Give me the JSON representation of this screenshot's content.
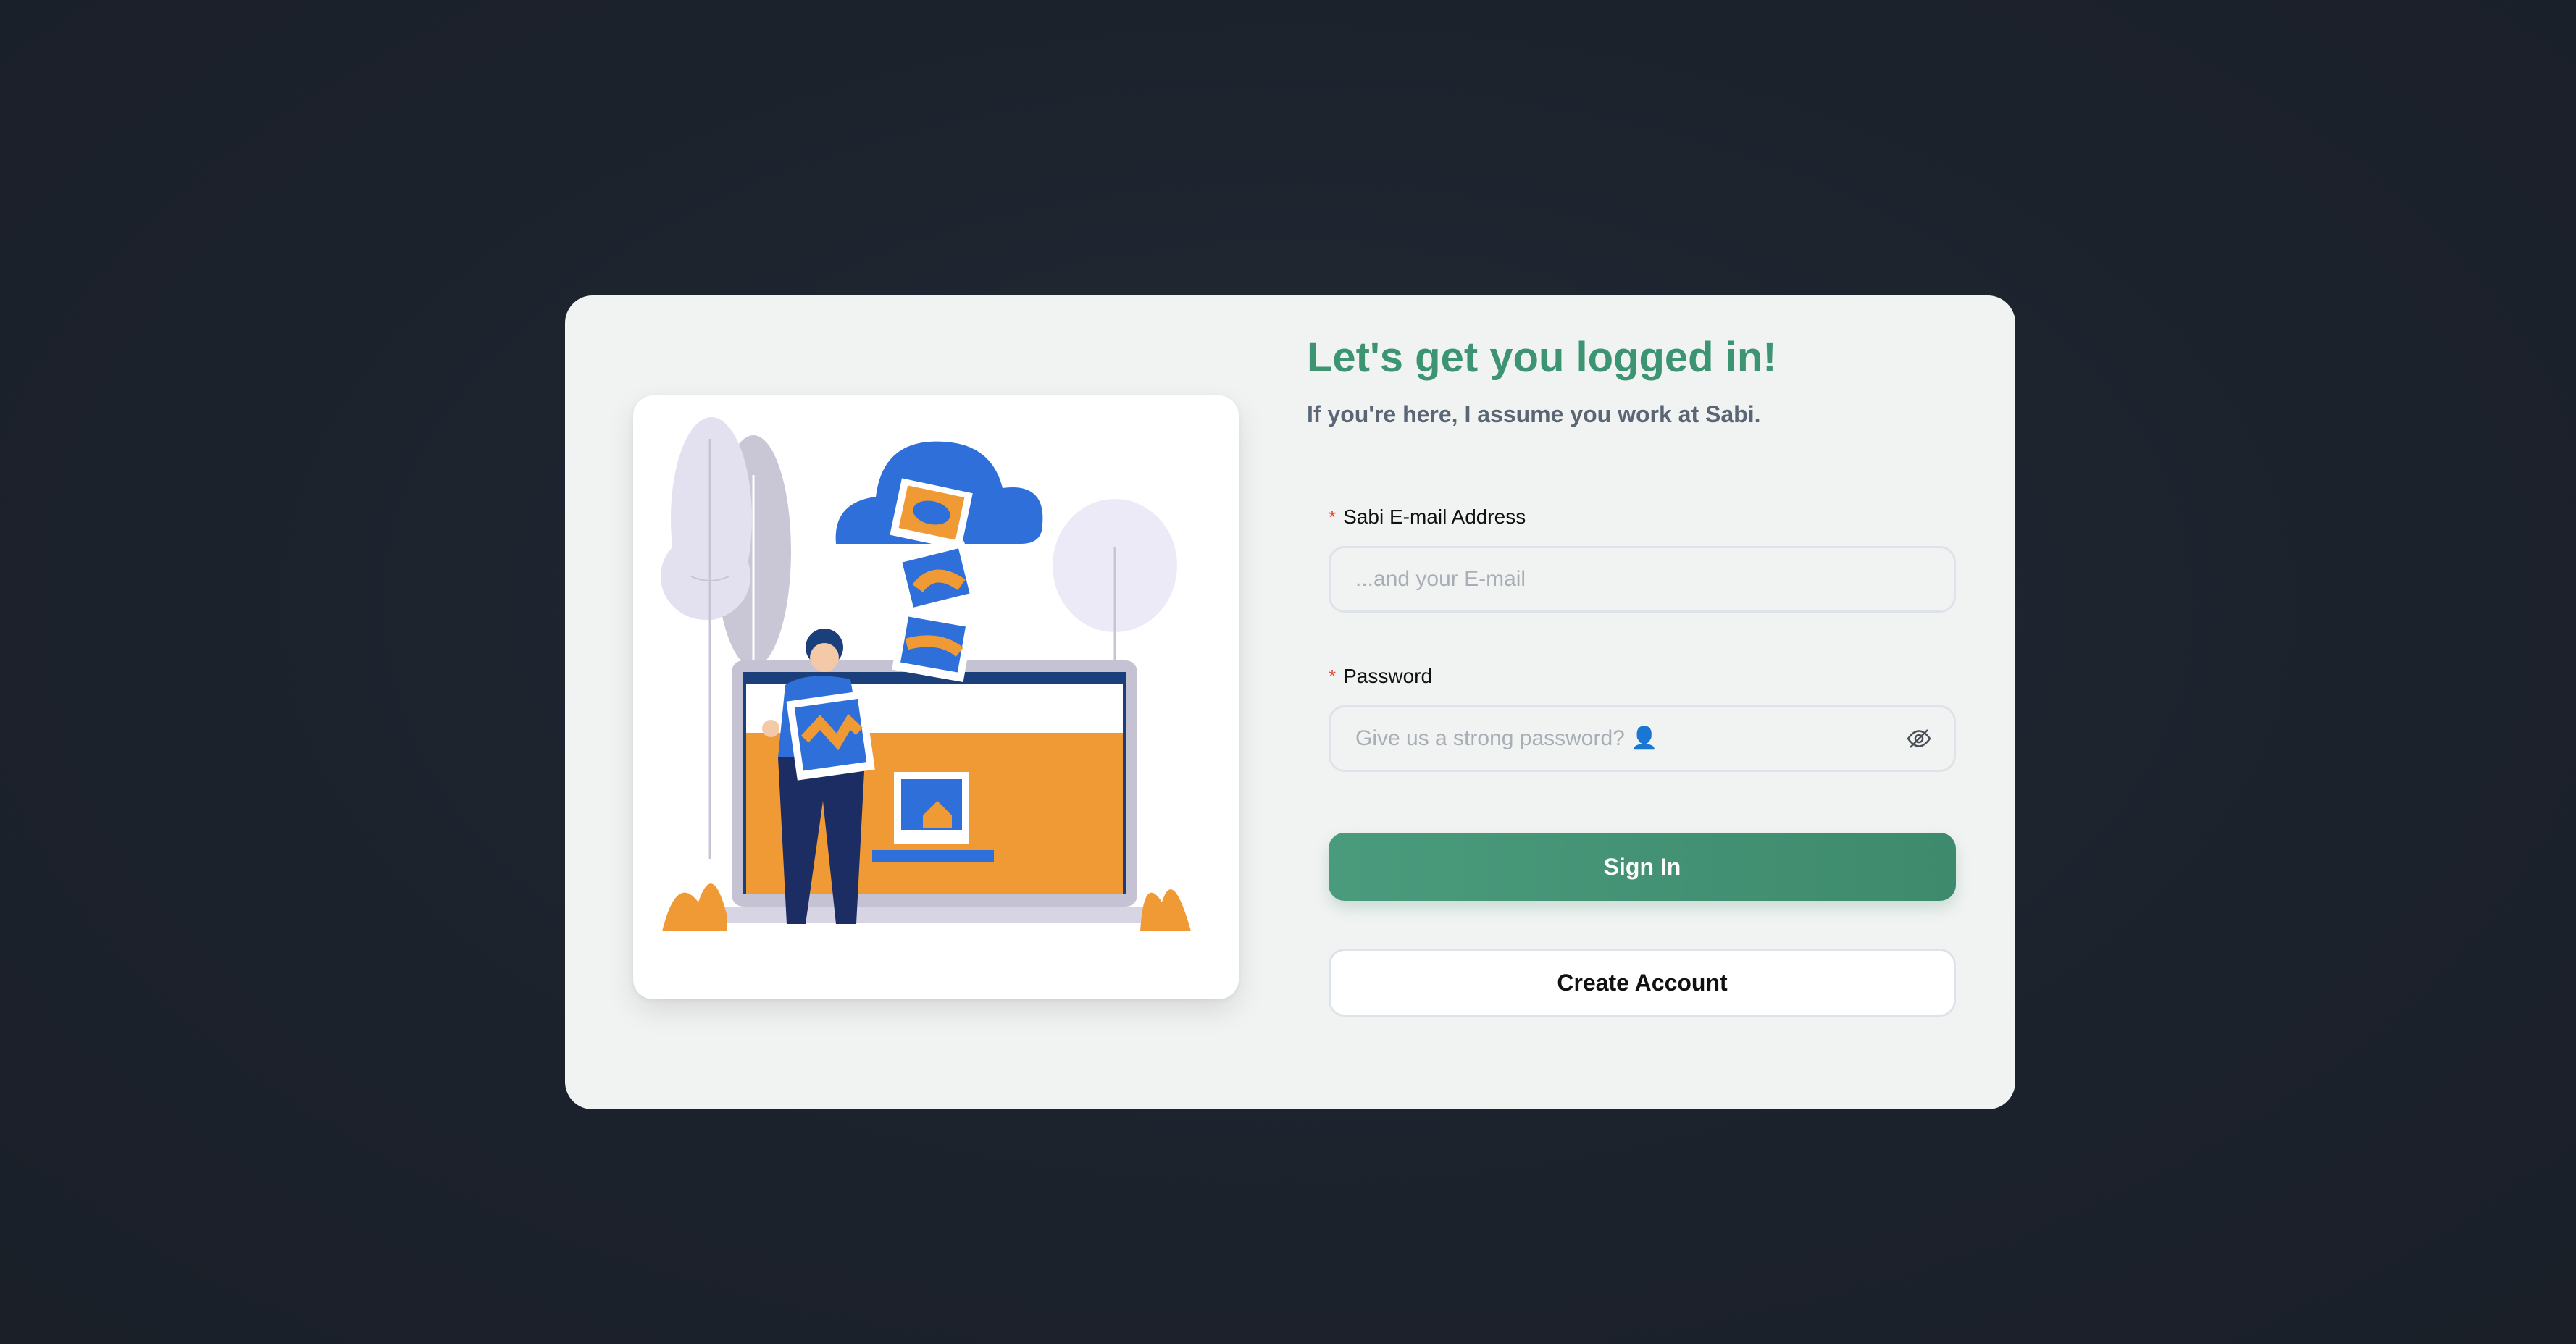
{
  "login": {
    "title": "Let's get you logged in!",
    "subtitle": "If you're here, I assume you work at Sabi.",
    "email": {
      "label": "Sabi E-mail Address",
      "required_mark": "*",
      "placeholder": "...and your E-mail",
      "value": ""
    },
    "password": {
      "label": "Password",
      "required_mark": "*",
      "placeholder": "Give us a strong password? 👤",
      "value": "",
      "toggle_icon": "eye-slash-icon"
    },
    "sign_in_label": "Sign In",
    "create_account_label": "Create Account"
  },
  "illustration": {
    "icon": "person-uploading-photos-illustration"
  },
  "colors": {
    "accent": "#3d9473",
    "background": "#1e242e",
    "card": "#f1f3f2",
    "required": "#e24a3b"
  }
}
